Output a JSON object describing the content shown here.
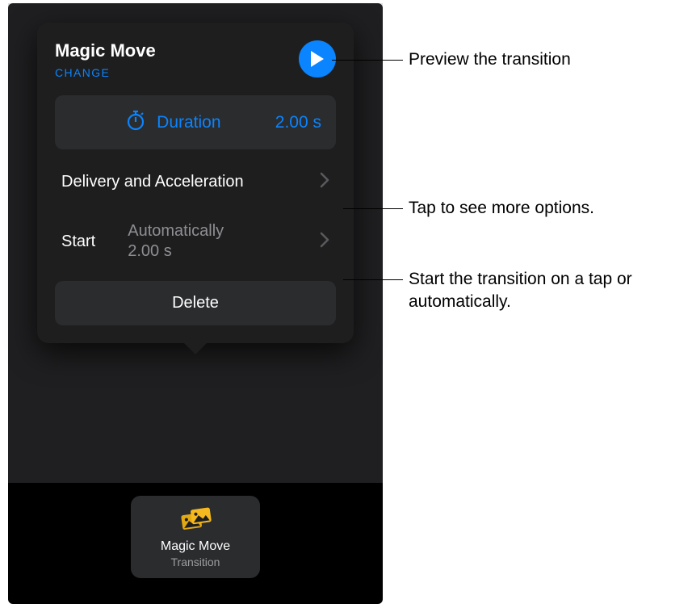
{
  "popover": {
    "title": "Magic Move",
    "change_label": "CHANGE",
    "duration_label": "Duration",
    "duration_value": "2.00 s",
    "delivery_label": "Delivery and Acceleration",
    "start_label": "Start",
    "start_value": "Automatically\n2.00 s",
    "delete_label": "Delete"
  },
  "chip": {
    "name": "Magic Move",
    "sub": "Transition"
  },
  "callouts": {
    "preview": "Preview the transition",
    "delivery": "Tap to see more options.",
    "start": "Start the transition on a tap or automatically."
  }
}
